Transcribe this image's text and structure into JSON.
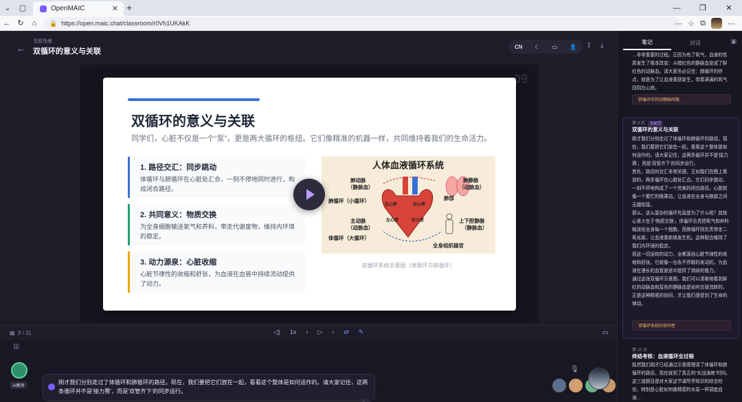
{
  "browser": {
    "tab_title": "OpenMAIC",
    "url": "https://open.maic.chat/classroom/r0Vh1UKAkK"
  },
  "header": {
    "scene_label": "当前场景",
    "title": "双循环的意义与关联",
    "lang_button": "CN"
  },
  "slide": {
    "number": "09",
    "title": "双循环的意义与关联",
    "subtitle": "同学们，心脏不仅是一个“泵”，更是两大循环的枢纽。它们像精准的机器一样，共同维持着我们的生命活力。",
    "cards": [
      {
        "title": "1. 路径交汇：同步跳动",
        "text": "体循环与肺循环在心脏处汇合，一刻不停地同时进行，构成闭合路径。",
        "color": "#3b6fd4"
      },
      {
        "title": "2. 共同意义：物质交换",
        "text": "为全身细胞输送氧气和养料，带走代谢废物，维持内环境的稳定。",
        "color": "#22a06b"
      },
      {
        "title": "3. 动力源泉：心脏收缩",
        "text": "心脏节律性的收缩和舒张，为血液在血管中持续流动提供了动力。",
        "color": "#f0a500"
      }
    ],
    "diagram": {
      "title": "人体血液循环系统",
      "labels": {
        "pulmonary_artery": "肺动脉",
        "pulmonary_artery_sub": "（静脉血）",
        "pulmonary_vein": "肺静脉",
        "pulmonary_vein_sub": "（动脉血）",
        "lungs": "肺部",
        "pulmonary_circ": "肺循环（小循环）",
        "left_atrium": "左心房",
        "right_atrium": "右心房",
        "left_ventricle": "左心室",
        "right_ventricle": "右心室",
        "aorta": "主动脉",
        "aorta_sub": "（动脉血）",
        "vena_cava": "上下腔静脉",
        "vena_cava_sub": "（静脉血）",
        "systemic_circ": "体循环（大循环）",
        "organs": "全身组织器官"
      }
    },
    "caption": "双循环系统示意图（体循环与肺循环）"
  },
  "playback": {
    "counter": "9 / 11",
    "speed": "1x"
  },
  "chat": {
    "ai_label": "AI教师",
    "message": "刚才我们分别走过了体循环和肺循环的路径。现在，我们要把它们放在一起，看看这个整体是如何运作的。请大家记住，这两条循环并不是'接力赛'，而是'双管齐下'的同步运行。"
  },
  "sidebar": {
    "tabs": [
      "笔记",
      "对话"
    ],
    "top_note": "…非常重要的过程。正因为有了氧气，血液的性质发生了根本改变：从暗红色的静脉血变成了鲜红色的动脉血。请大家务必记住：肺循环的终点，就是为了让血液重获新生，带着满满的氧气回到左心房。",
    "top_chip": "肺循环中的动静脉回路",
    "current": {
      "meta": "第 9 页",
      "badge": "当前页",
      "title": "双循环的意义与关联",
      "paragraphs": [
        "刚才我们分别走过了体循环和肺循环的路径。现在，我们要把它们放在一起，看看这个整体是如何运作的。请大家记住，这两条循环并不是'接力赛'，而是'双管齐下'的同步运行。",
        "首先，路径的交汇非常关键。正如我们在图上看到的，两条循环在心脏处汇合。它们同步跳动，一刻不停地构成了一个完美的闭合路径。心脏就像一个繁忙的换乘站，让血液在全身与肺部之间无缝衔接。",
        "那么，这么复杂的循环究竟是为了什么呢？其核心意义在于'物质交换'。体循环负责把氧气和养料输送给全身每一个细胞，而肺循环则负责带走二氧化碳，让血液重新焕发生机。这种配合维持了我们内环境的稳定。",
        "而这一切运转的动力，全都源自心脏节律性的收缩和舒张。它就像一台永不停歇的发动机，为血液在漫长的血管旅途中提供了持续的推力。",
        "通过这张双循环示意图，我们可以清晰地看到鲜红的动脉血和蓝色的静脉血是如何交替流转的。正是这种精密的协同，才让我们感受到了生命的律动。"
      ],
      "chip": "双循环系统的协同性"
    },
    "next": {
      "meta": "第 10 页",
      "title": "终结考核：血液循环全过程",
      "text": "既然我们刚才已经通过示意图理清了体循环和肺循环的路径，现在就到了真正的“实战演练”时间。这三道题目是对大家这节课所学知识的综合检验，特别是心脏如何像精密的水泵一样调度血液…"
    }
  }
}
